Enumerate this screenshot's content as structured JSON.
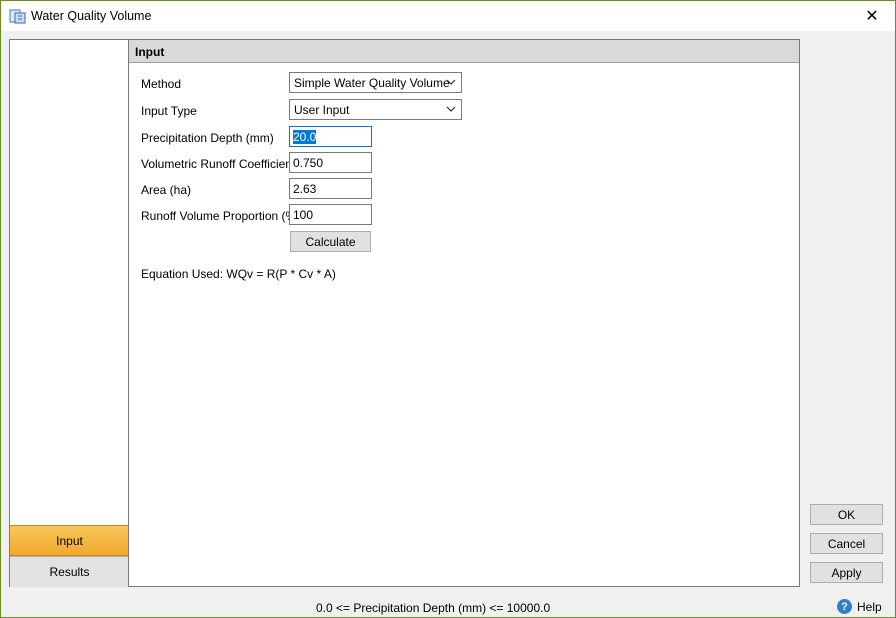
{
  "window": {
    "title": "Water Quality Volume",
    "close_symbol": "✕",
    "app_icon": "water-quality-icon"
  },
  "nav": {
    "tabs": [
      {
        "label": "Input",
        "active": true
      },
      {
        "label": "Results",
        "active": false
      }
    ]
  },
  "section": {
    "header": "Input"
  },
  "form": {
    "method_label": "Method",
    "method_value": "Simple Water Quality Volume",
    "input_type_label": "Input Type",
    "input_type_value": "User Input",
    "precip_label": "Precipitation Depth (mm)",
    "precip_value": "20.0",
    "runoff_coef_label": "Volumetric Runoff Coefficient",
    "runoff_coef_value": "0.750",
    "area_label": "Area (ha)",
    "area_value": "2.63",
    "runoff_prop_label": "Runoff Volume Proportion (%)",
    "runoff_prop_value": "100",
    "calculate_label": "Calculate",
    "equation": "Equation Used: WQv = R(P * Cv * A)"
  },
  "buttons": {
    "ok": "OK",
    "cancel": "Cancel",
    "apply": "Apply"
  },
  "status": {
    "text": "0.0 <= Precipitation Depth (mm) <= 10000.0",
    "help_label": "Help",
    "help_symbol": "?"
  },
  "colors": {
    "active_tab": "#f5b942",
    "focus": "#0078d7",
    "help": "#2f7fd0"
  }
}
